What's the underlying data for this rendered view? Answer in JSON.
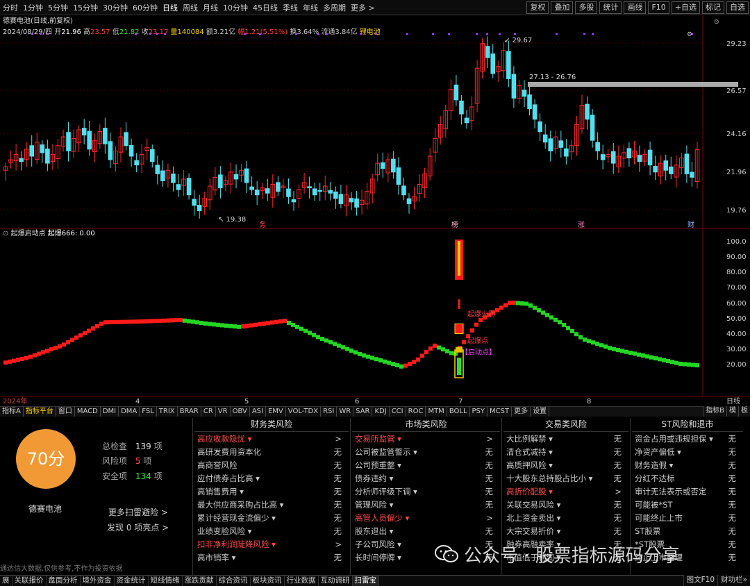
{
  "timeframes": [
    "分时",
    "1分钟",
    "5分钟",
    "15分钟",
    "30分钟",
    "60分钟",
    "日线",
    "周线",
    "月线",
    "10分钟",
    "45日线",
    "季线",
    "年线",
    "多周期",
    "更多 >"
  ],
  "active_timeframe": "日线",
  "tools": [
    "复权",
    "叠加",
    "多股",
    "统计",
    "画线",
    "F10",
    "+自选",
    "标记",
    "自选"
  ],
  "stock": {
    "name_line": "德赛电池(日线,前复权)",
    "date": "2024/08/29/四",
    "open_label": "开",
    "open": "21.96",
    "high_label": "高",
    "high": "23.57",
    "low_label": "低",
    "low": "21.82",
    "close_label": "收",
    "close": "23.17",
    "vol_label": "量",
    "vol": "140084",
    "amt_label": "额",
    "amt": "3.21亿",
    "chg_label": "幅",
    "chg": "1.21(5.51%)",
    "turn_label": "换",
    "turn": "3.64%",
    "flow_label": "流通",
    "flow": "3.84亿",
    "concept": "锂电池"
  },
  "price_axis": [
    "29.23",
    "26.57",
    "24.16",
    "21.96",
    "19.76"
  ],
  "price_annot": {
    "high": "29.67",
    "low": "19.38",
    "range": "27.13 - 26.76"
  },
  "event_marks": [
    "务",
    "榜",
    "涨",
    "财"
  ],
  "indicator": {
    "name": "起爆启动点",
    "label": "起爆666:",
    "value": "0.00",
    "axis": [
      "100.0",
      "90.00",
      "80.00",
      "70.00",
      "60.00",
      "50.00",
      "40.00",
      "30.00",
      "20.00"
    ],
    "signals": [
      "起爆火箭",
      "起爆点",
      "【启动点】"
    ]
  },
  "xaxis": [
    "2024年",
    "4",
    "5",
    "6",
    "7",
    "8",
    "日线"
  ],
  "tabs": [
    "指标A",
    "指标平台",
    "窗口",
    "MACD",
    "DMI",
    "DMA",
    "FSL",
    "TRIX",
    "BRAR",
    "CR",
    "VR",
    "OBV",
    "ASI",
    "EMV",
    "VOL-TDX",
    "RSI",
    "WR",
    "SAR",
    "KDJ",
    "CCI",
    "ROC",
    "MTM",
    "BOLL",
    "PSY",
    "MCST",
    "更多",
    "设置"
  ],
  "tabs_right": [
    "指标B",
    "模",
    "板"
  ],
  "panel": {
    "score": "70分",
    "total_label": "总检查",
    "total": "139",
    "total_unit": "项",
    "risk_label": "风险项",
    "risk": "5",
    "risk_unit": "项",
    "safe_label": "安全项",
    "safe": "134",
    "safe_unit": "项",
    "stock_name": "德赛电池",
    "more": "更多扫雷避险 >",
    "found_prefix": "发现",
    "found": "0",
    "found_suffix": "项亮点 >",
    "disclaimer": "通达信大数据,仅供参考,不作为投资依据",
    "columns": [
      {
        "title": "财务类风险",
        "rows": [
          {
            "label": "高应收款隐忧 ▾",
            "status": ">",
            "risk": true
          },
          {
            "label": "高研发费用资本化",
            "status": "无"
          },
          {
            "label": "高商誉风险",
            "status": "无"
          },
          {
            "label": "应付债券占比高 ▾",
            "status": "无"
          },
          {
            "label": "高销售费用 ▾",
            "status": "无"
          },
          {
            "label": "最大供应商采购占比高 ▾",
            "status": "无"
          },
          {
            "label": "累计经营现金流偏少 ▾",
            "status": "无"
          },
          {
            "label": "业绩变脸风险 ▾",
            "status": "无"
          },
          {
            "label": "扣非净利润陡降风险 ▾",
            "status": ">",
            "risk": true
          },
          {
            "label": "高市销率 ▾",
            "status": "无"
          }
        ]
      },
      {
        "title": "市场类风险",
        "rows": [
          {
            "label": "交易所监管 ▾",
            "status": ">",
            "risk": true
          },
          {
            "label": "公司被监管警示 ▾",
            "status": "无"
          },
          {
            "label": "公司预重整 ▾",
            "status": "无"
          },
          {
            "label": "债券违约 ▾",
            "status": "无"
          },
          {
            "label": "分析师评级下调 ▾",
            "status": "无"
          },
          {
            "label": "管理风险 ▾",
            "status": "无"
          },
          {
            "label": "高管人员偏少 ▾",
            "status": ">",
            "risk": true
          },
          {
            "label": "股东退出 ▾",
            "status": "无"
          },
          {
            "label": "子公司风险 ▾",
            "status": "无"
          },
          {
            "label": "长时间停牌 ▾",
            "status": "无"
          }
        ]
      },
      {
        "title": "交易类风险",
        "rows": [
          {
            "label": "大比例解禁 ▾",
            "status": "无"
          },
          {
            "label": "清仓式减持 ▾",
            "status": "无"
          },
          {
            "label": "高质押风险 ▾",
            "status": "无"
          },
          {
            "label": "十大股东总持股占比小 ▾",
            "status": "无"
          },
          {
            "label": "高折价配股 ▾",
            "status": ">",
            "risk": true
          },
          {
            "label": "关联交易风险 ▾",
            "status": "无"
          },
          {
            "label": "北上资金卖出 ▾",
            "status": "无"
          },
          {
            "label": "大宗交易折价 ▾",
            "status": "无"
          },
          {
            "label": "融券高融卖率 ▾",
            "status": "无"
          },
          {
            "label": "市值低于利润 ▾",
            "status": "无"
          }
        ]
      },
      {
        "title": "ST风险和退市",
        "rows": [
          {
            "label": "资金占用或违规担保 ▾",
            "status": "无"
          },
          {
            "label": "净资产偏低 ▾",
            "status": "无"
          },
          {
            "label": "财务造假 ▾",
            "status": "无"
          },
          {
            "label": "分红不达标",
            "status": "无"
          },
          {
            "label": "审计无法表示或否定",
            "status": "无"
          },
          {
            "label": "可能被*ST",
            "status": "无"
          },
          {
            "label": "可能终止上市",
            "status": "无"
          },
          {
            "label": "ST股票",
            "status": "无"
          },
          {
            "label": "*ST股票",
            "status": "无"
          },
          {
            "label": "终止上市整理",
            "status": "无"
          }
        ]
      }
    ]
  },
  "bottom_tabs": [
    "展",
    "关联报价",
    "盘面分析",
    "境外资金",
    "资金统计",
    "短线情绪",
    "涨跌贡献",
    "综合资讯",
    "板块资讯",
    "行业数据",
    "互动调研",
    "扫雷宝"
  ],
  "bottom_active": "扫雷宝",
  "bottom_right": [
    "图文F10",
    "财功栏»"
  ],
  "watermark": "公众号 · 股票指标源码分享",
  "colors": {
    "up": "#ff2b2b",
    "down": "#52e0f0",
    "ind_up": "#ff1a1a",
    "ind_down": "#23d623",
    "score_bg": "#f19a35",
    "risk_text": "#ff4b4b"
  }
}
